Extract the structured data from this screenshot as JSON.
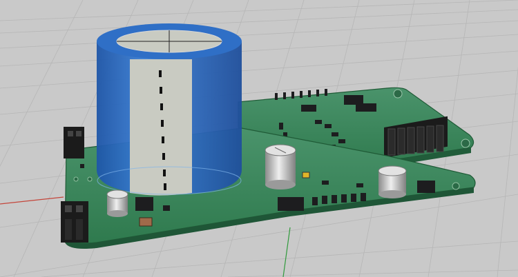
{
  "app": {
    "viewport": {
      "view_label": "",
      "background": "#c9c9c9",
      "grid_color": "#b6b6b6",
      "axes": {
        "x_color": "#c4453a",
        "y_color": "#2f9a3b",
        "origin_label": ""
      }
    },
    "model": {
      "pcb_color": "#2f7a4e",
      "pcb_edge_color": "#1f5a36",
      "capacitor_body_color": "#2f6fc6",
      "capacitor_stripe_color": "#c9cbc2",
      "component_color": "#1d1d1f",
      "header_pin_color": "#c7b078"
    }
  }
}
